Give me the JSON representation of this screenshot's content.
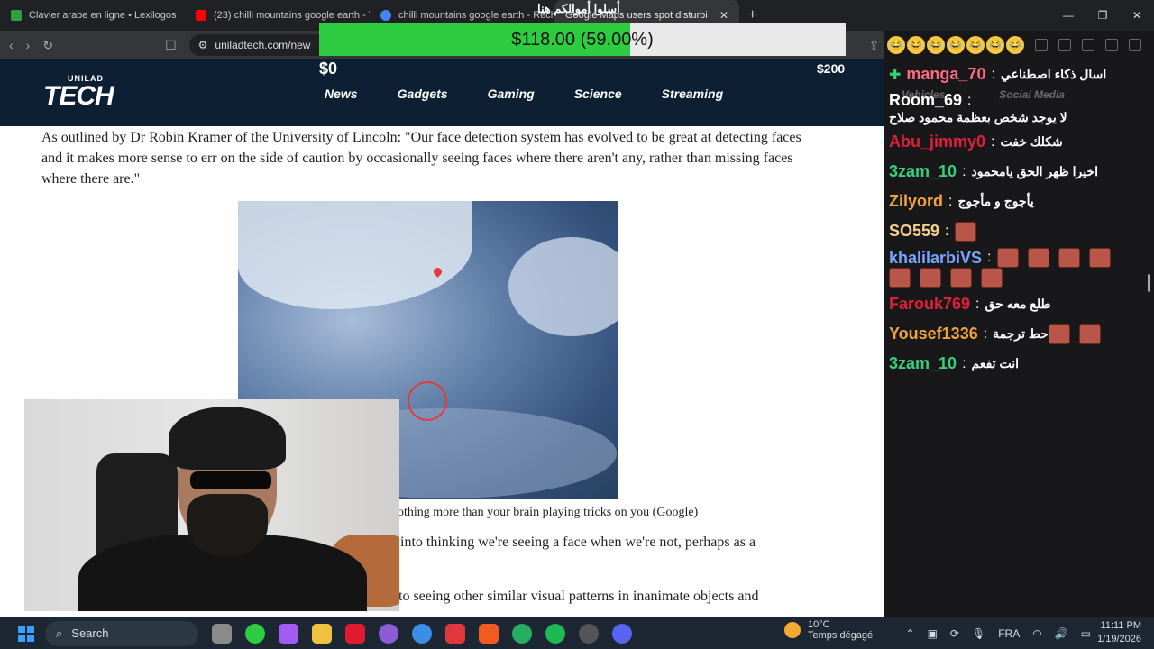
{
  "browser": {
    "tabs": [
      {
        "title": "Clavier arabe en ligne • Lexilogos",
        "favicon_color": "#2ea043"
      },
      {
        "title": "(23) chilli mountains google earth - Y",
        "favicon_color": "#ff0000"
      },
      {
        "title": "chilli mountains google earth - Rech",
        "favicon_color": "#4285f4"
      },
      {
        "title": "Google Maps users spot disturbi",
        "favicon_color": "#cccccc"
      }
    ],
    "new_tab": "+",
    "url": "uniladtech.com/new"
  },
  "site": {
    "logo_small": "UNILAD",
    "logo_big": "TECH",
    "nav": [
      "News",
      "Gadgets",
      "Gaming",
      "Science",
      "Streaming"
    ],
    "nav_faded": [
      "Vehicles",
      "Social Media"
    ]
  },
  "donation": {
    "label": "$118.00 (59.00%)",
    "progress": 0.59,
    "min": "$0",
    "max": "$200",
    "overlay_text": "أسلوا أموالكم هنا"
  },
  "article": {
    "para1": "As outlined by Dr Robin Kramer of the University of Lincoln: \"Our face detection system has evolved to be great at detecting faces and it makes more sense to err on the side of caution by occasionally seeing faces where there aren't any, rather than missing faces where there are.\"",
    "caption": "othing more than your brain playing tricks on you (Google)",
    "para2": "into thinking we're seeing a face when we're not, perhaps as a",
    "para3": "to seeing other similar visual patterns in inanimate objects and"
  },
  "chat": {
    "messages": [
      {
        "user": "manga_70",
        "color": "#ff6b81",
        "text": "اسال ذكاء اصطناعي",
        "badge": true
      },
      {
        "user": "Room_69",
        "color": "#ffffff",
        "text": "لا يوجد شخص بعظمة محمود صلاح"
      },
      {
        "user": "Abu_jimmy0",
        "color": "#e0203a",
        "text": "شكلك خفت"
      },
      {
        "user": "3zam_10",
        "color": "#3ad07a",
        "text": "اخيرا ظهر الحق يامحمود"
      },
      {
        "user": "Zilyord",
        "color": "#f2a33a",
        "text": "يأجوج و مأجوج"
      },
      {
        "user": "SO559",
        "color": "#f5d08a",
        "text": "",
        "emotes": 1
      },
      {
        "user": "khalilarbiVS",
        "color": "#7aa3ff",
        "text": "",
        "emotes": 8
      },
      {
        "user": "Farouk769",
        "color": "#e0203a",
        "text": "طلع معه حق"
      },
      {
        "user": "Yousef1336",
        "color": "#f2a33a",
        "text": "حط ترجمة",
        "emotes": 2
      },
      {
        "user": "3zam_10",
        "color": "#3ad07a",
        "text": "انت تفعم"
      }
    ]
  },
  "taskbar": {
    "search_label": "Search",
    "weather_temp": "10°C",
    "weather_desc": "Temps dégagé",
    "lang": "FRA",
    "time": "11:11 PM",
    "date": "1/19/2026"
  }
}
